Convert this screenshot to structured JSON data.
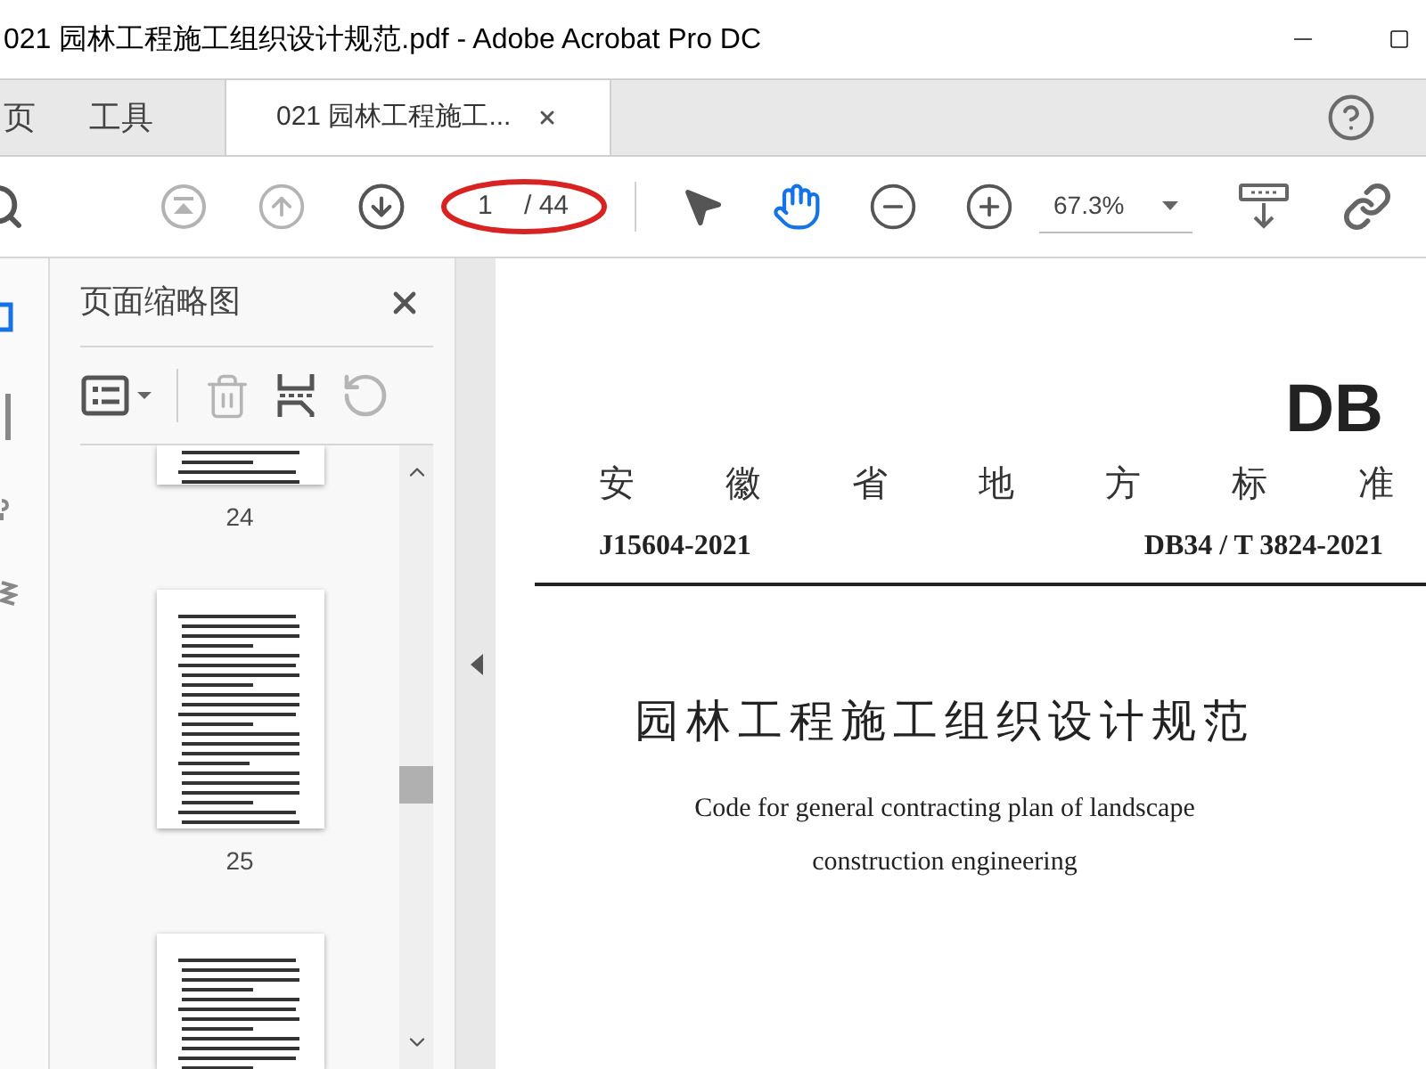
{
  "window": {
    "title": "021 园林工程施工组织设计规范.pdf - Adobe Acrobat Pro DC"
  },
  "tabs": [
    {
      "label": "页",
      "kind": "nav",
      "selected": false
    },
    {
      "label": "工具",
      "kind": "nav",
      "selected": false
    },
    {
      "label": "021 园林工程施工...",
      "kind": "document",
      "selected": true
    }
  ],
  "toolbar": {
    "page_number": "1",
    "page_total": "/ 44",
    "tools": [
      {
        "kind": "select",
        "selected": false
      },
      {
        "kind": "hand",
        "selected": true
      }
    ],
    "zoom": "67.3%"
  },
  "thumbnails_panel": {
    "title": "页面缩略图",
    "pages": [
      {
        "kind": "top-cut",
        "label": "24"
      },
      {
        "kind": "full",
        "label": "25"
      },
      {
        "kind": "bottom-cut"
      }
    ]
  },
  "document": {
    "badge": "DB",
    "region": [
      "安",
      "徽",
      "省",
      "地",
      "方",
      "标",
      "准"
    ],
    "record_number": "J15604-2021",
    "standard_number": "DB34 / T 3824-2021",
    "title": "园林工程施工组织设计规范",
    "english_title": [
      "Code for general contracting plan of landscape",
      "construction engineering"
    ]
  }
}
